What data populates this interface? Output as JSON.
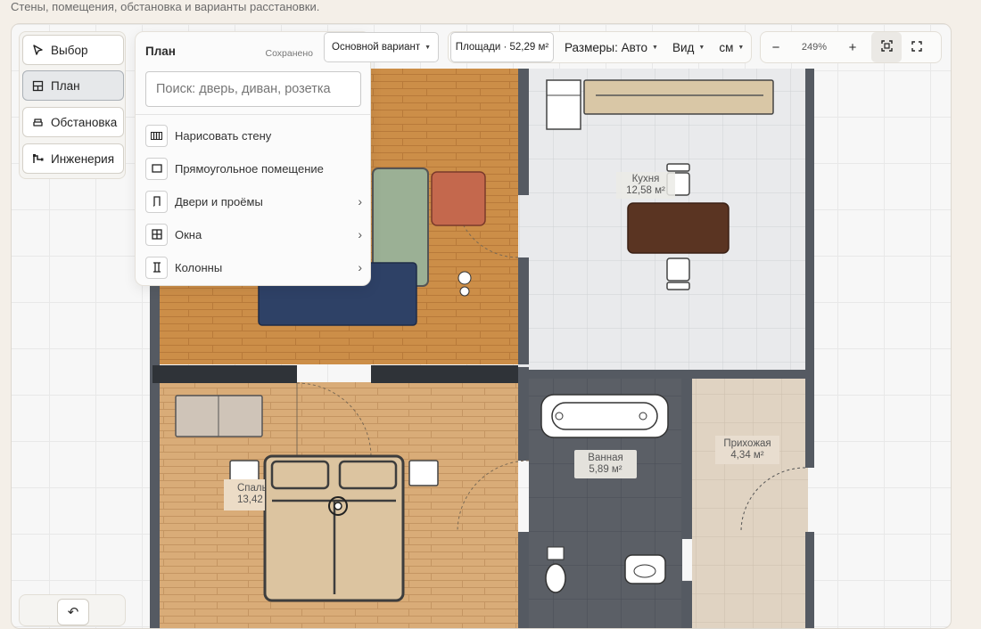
{
  "caption": "Стены, помещения, обстановка и варианты расстановки.",
  "toolbox": {
    "select": "Выбор",
    "plan": "План",
    "furniture": "Обстановка",
    "engineering": "Инженерия"
  },
  "panel": {
    "title": "План",
    "saved": "Сохранено",
    "search_placeholder": "Поиск: дверь, диван, розетка",
    "items": [
      "Нарисовать стену",
      "Прямоугольное помещение",
      "Двери и проёмы",
      "Окна",
      "Колонны"
    ]
  },
  "topbar": {
    "variant": "Основной вариант",
    "areas": "Площади · 52,29 м²",
    "sizes": "Размеры: Авто",
    "view": "Вид",
    "units": "см",
    "zoom": "249%",
    "zoom_out": "−",
    "zoom_in": "+"
  },
  "rooms": {
    "kitchen_name": "Кухня",
    "kitchen_area": "12,58 м²",
    "bath_name": "Ванная",
    "bath_area": "5,89 м²",
    "hall_name": "Прихожая",
    "hall_area": "4,34 м²",
    "bedroom_name": "Спальня",
    "bedroom_area": "13,42 м²"
  },
  "colors": {
    "wood": "#cc8e48",
    "wall": "#555a62",
    "accent": "#2b2b2b"
  }
}
